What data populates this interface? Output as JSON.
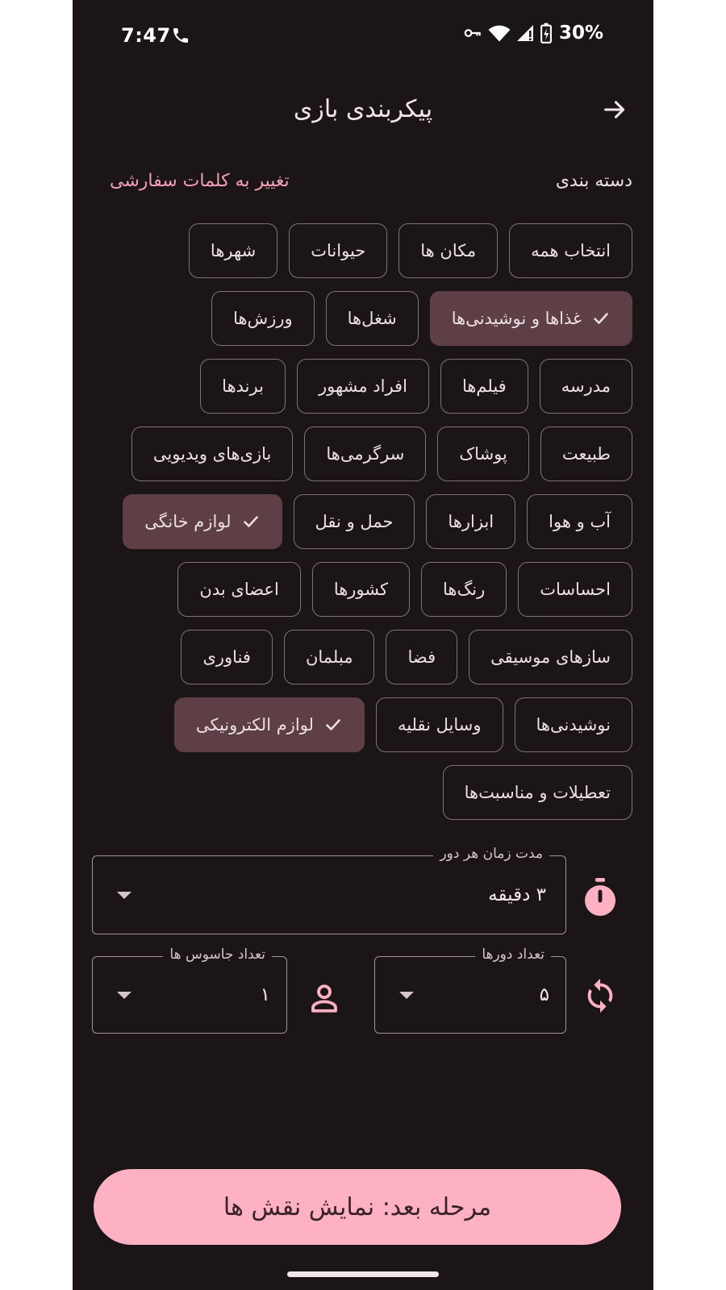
{
  "status_bar": {
    "time": "7:47",
    "battery": "30%"
  },
  "header": {
    "title": "پیکربندی بازی"
  },
  "categories": {
    "label": "دسته بندی",
    "custom_words_link": "تغییر به کلمات سفارشی",
    "rows": [
      [
        {
          "label": "انتخاب همه",
          "selected": false
        },
        {
          "label": "مکان ها",
          "selected": false
        },
        {
          "label": "حیوانات",
          "selected": false
        },
        {
          "label": "شهرها",
          "selected": false
        }
      ],
      [
        {
          "label": "غذاها و نوشیدنی‌ها",
          "selected": true
        },
        {
          "label": "شغل‌ها",
          "selected": false
        },
        {
          "label": "ورزش‌ها",
          "selected": false
        }
      ],
      [
        {
          "label": "مدرسه",
          "selected": false
        },
        {
          "label": "فیلم‌ها",
          "selected": false
        },
        {
          "label": "افراد مشهور",
          "selected": false
        },
        {
          "label": "برندها",
          "selected": false
        }
      ],
      [
        {
          "label": "طبیعت",
          "selected": false
        },
        {
          "label": "پوشاک",
          "selected": false
        },
        {
          "label": "سرگرمی‌ها",
          "selected": false
        },
        {
          "label": "بازی‌های ویدیویی",
          "selected": false
        }
      ],
      [
        {
          "label": "آب و هوا",
          "selected": false
        },
        {
          "label": "ابزارها",
          "selected": false
        },
        {
          "label": "حمل و نقل",
          "selected": false
        },
        {
          "label": "لوازم خانگی",
          "selected": true
        }
      ],
      [
        {
          "label": "احساسات",
          "selected": false
        },
        {
          "label": "رنگ‌ها",
          "selected": false
        },
        {
          "label": "کشورها",
          "selected": false
        },
        {
          "label": "اعضای بدن",
          "selected": false
        }
      ],
      [
        {
          "label": "سازهای موسیقی",
          "selected": false
        },
        {
          "label": "فضا",
          "selected": false
        },
        {
          "label": "مبلمان",
          "selected": false
        },
        {
          "label": "فناوری",
          "selected": false
        }
      ],
      [
        {
          "label": "نوشیدنی‌ها",
          "selected": false
        },
        {
          "label": "وسایل نقلیه",
          "selected": false
        },
        {
          "label": "لوازم الکترونیکی",
          "selected": true
        }
      ],
      [
        {
          "label": "تعطیلات و مناسبت‌ها",
          "selected": false
        }
      ]
    ]
  },
  "settings": {
    "round_duration": {
      "label": "مدت زمان هر دور",
      "value": "۳ دقیقه"
    },
    "rounds_count": {
      "label": "تعداد دورها",
      "value": "۵"
    },
    "spies_count": {
      "label": "تعداد جاسوس ها",
      "value": "۱"
    }
  },
  "next_button": {
    "label": "مرحله بعد: نمایش نقش ها"
  },
  "colors": {
    "background": "#1c1517",
    "accent": "#ffb1c4",
    "link": "#f39fb4",
    "chip_selected": "#5d3f45",
    "chip_border": "#807377"
  },
  "icons": {
    "back": "arrow-forward-icon",
    "timer": "timer-icon",
    "rounds": "sync-icon",
    "spies": "person-icon",
    "check": "check-icon"
  }
}
